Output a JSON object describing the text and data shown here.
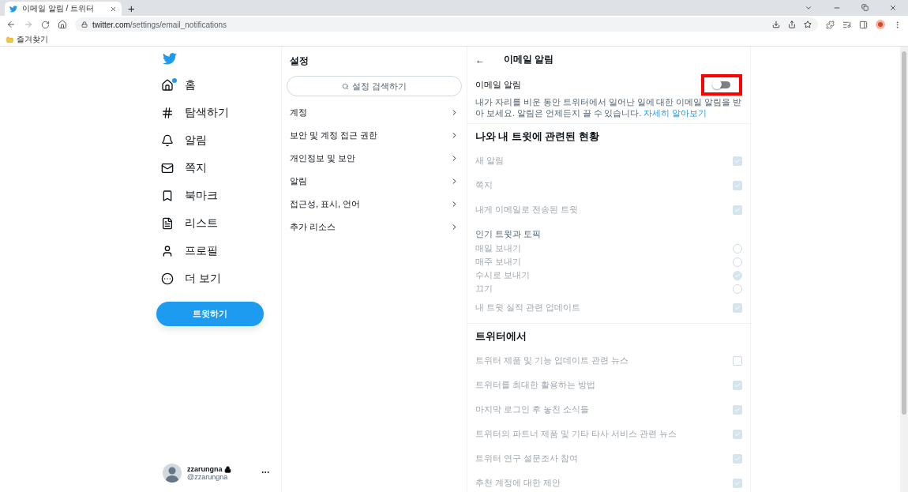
{
  "browser": {
    "tab_title": "이메일 알림 / 트위터",
    "new_tab": "+",
    "url_host": "twitter.com",
    "url_path": "/settings/email_notifications",
    "bookmarks": [
      {
        "label": "즐겨찾기"
      }
    ]
  },
  "sidebar": {
    "nav": [
      {
        "label": "홈",
        "notification_dot": true
      },
      {
        "label": "탐색하기",
        "notification_dot": false
      },
      {
        "label": "알림",
        "notification_dot": false
      },
      {
        "label": "쪽지",
        "notification_dot": false
      },
      {
        "label": "북마크",
        "notification_dot": false
      },
      {
        "label": "리스트",
        "notification_dot": false
      },
      {
        "label": "프로필",
        "notification_dot": false
      },
      {
        "label": "더 보기",
        "notification_dot": false
      }
    ],
    "tweet_button": "트윗하기",
    "account": {
      "name": "zzarungna",
      "handle": "@zzarungna",
      "protected": true
    }
  },
  "settings": {
    "title": "설정",
    "search_placeholder": "설정 검색하기",
    "items": [
      {
        "label": "계정"
      },
      {
        "label": "보안 및 계정 접근 권한"
      },
      {
        "label": "개인정보 및 보안"
      },
      {
        "label": "알림"
      },
      {
        "label": "접근성, 표시, 언어"
      },
      {
        "label": "추가 리소스"
      }
    ]
  },
  "email": {
    "back": "←",
    "title": "이메일 알림",
    "toggle_label": "이메일 알림",
    "toggle_on": false,
    "description": "내가 자리를 비운 동안 트위터에서 일어난 일에 대한 이메일 알림을 받아 보세요. 알림은 언제든지 끌 수 있습니다.",
    "link": "자세히 알아보기",
    "sections": [
      {
        "heading": "나와 내 트윗에 관련된 현황",
        "items": [
          {
            "kind": "checkbox",
            "label": "새 알림",
            "checked": true
          },
          {
            "kind": "checkbox",
            "label": "쪽지",
            "checked": true
          },
          {
            "kind": "checkbox",
            "label": "내게 이메일로 전송된 트윗",
            "checked": true
          },
          {
            "kind": "group",
            "label": "인기 트윗과 토픽"
          },
          {
            "kind": "radio",
            "label": "매일 보내기",
            "selected": false
          },
          {
            "kind": "radio",
            "label": "매주 보내기",
            "selected": false
          },
          {
            "kind": "radio",
            "label": "수시로 보내기",
            "selected": true
          },
          {
            "kind": "radio",
            "label": "끄기",
            "selected": false
          },
          {
            "kind": "checkbox",
            "label": "내 트윗 실적 관련 업데이트",
            "checked": true
          }
        ]
      },
      {
        "heading": "트위터에서",
        "items": [
          {
            "kind": "checkbox",
            "label": "트위터 제품 및 기능 업데이트 관련 뉴스",
            "checked": false
          },
          {
            "kind": "checkbox",
            "label": "트위터를 최대한 활용하는 방법",
            "checked": true
          },
          {
            "kind": "checkbox",
            "label": "마지막 로그인 후 놓친 소식들",
            "checked": true
          },
          {
            "kind": "checkbox",
            "label": "트위터의 파트너 제품 및 기타 타사 서비스 관련 뉴스",
            "checked": true
          },
          {
            "kind": "checkbox",
            "label": "트위터 연구 설문조사 참여",
            "checked": true
          },
          {
            "kind": "checkbox",
            "label": "추천 계정에 대한 제안",
            "checked": true
          }
        ]
      }
    ]
  }
}
